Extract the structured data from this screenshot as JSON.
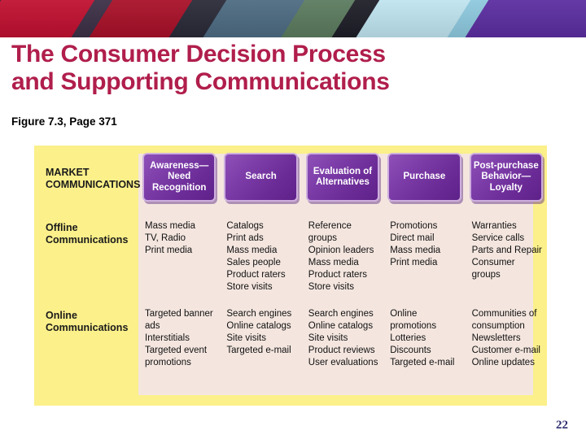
{
  "slide": {
    "title": "The Consumer Decision Process\nand Supporting Communications",
    "title_line1": "The Consumer Decision Process",
    "title_line2": "and Supporting Communications",
    "subtitle": "Figure 7.3, Page 371",
    "page_number": "22",
    "title_color": "#b01e4c",
    "panel_color": "#fbf08a",
    "content_color": "#f4e6df",
    "box_color": "#6b2b97",
    "page_number_color": "#2f3070"
  },
  "figure": {
    "row_labels": {
      "header": "MARKET\nCOMMUNICATIONS",
      "header_line1": "MARKET",
      "header_line2": "COMMUNICATIONS",
      "offline_line1": "Offline",
      "offline_line2": "Communications",
      "online_line1": "Online",
      "online_line2": "Communications"
    },
    "stages": [
      {
        "label": "Awareness—\nNeed\nRecognition"
      },
      {
        "label": "Search"
      },
      {
        "label": "Evaluation of\nAlternatives"
      },
      {
        "label": "Purchase"
      },
      {
        "label": "Post-purchase\nBehavior—\nLoyalty"
      }
    ],
    "offline": [
      [
        "Mass media",
        "TV, Radio",
        "Print media"
      ],
      [
        "Catalogs",
        "Print ads",
        "Mass media",
        "Sales people",
        "Product raters",
        "Store visits"
      ],
      [
        "Reference groups",
        "Opinion leaders",
        "Mass media",
        "Product raters",
        "Store visits"
      ],
      [
        "Promotions",
        "Direct mail",
        "Mass media",
        "Print media"
      ],
      [
        "Warranties",
        "Service calls",
        "Parts and Repair",
        "Consumer groups"
      ]
    ],
    "online": [
      [
        "Targeted banner ads",
        "Interstitials",
        "Targeted event promotions"
      ],
      [
        "Search engines",
        "Online catalogs",
        "Site visits",
        "Targeted e-mail"
      ],
      [
        "Search engines",
        "Online catalogs",
        "Site visits",
        "Product reviews",
        "User evaluations"
      ],
      [
        "Online promotions",
        "Lotteries",
        "Discounts",
        "Targeted e-mail"
      ],
      [
        "Communities of consumption",
        "Newsletters",
        "Customer e-mail",
        "Online updates"
      ]
    ]
  }
}
